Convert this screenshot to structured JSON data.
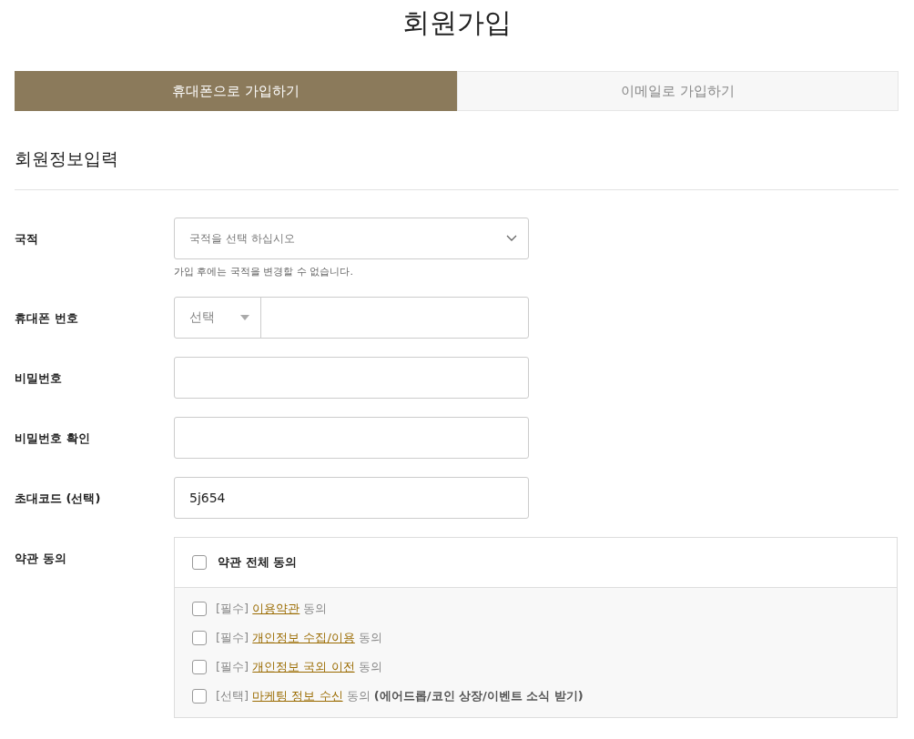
{
  "title": "회원가입",
  "tabs": [
    {
      "label": "휴대폰으로 가입하기",
      "selected": true
    },
    {
      "label": "이메일로 가입하기",
      "selected": false
    }
  ],
  "section_title": "회원정보입력",
  "fields": [
    {
      "kind": "select",
      "label": "국적",
      "placeholder": "국적을 선택 하십시오",
      "hint": "가입 후에는 국적을 변경할 수 없습니다."
    },
    {
      "kind": "phone",
      "label": "휴대폰 번호",
      "code": "선택"
    },
    {
      "kind": "password",
      "label": "비밀번호"
    },
    {
      "kind": "password",
      "label": "비밀번호 확인"
    },
    {
      "kind": "text",
      "label": "초대코드 (선택)",
      "value": "5j654"
    },
    {
      "kind": "terms",
      "label": "약관 동의"
    }
  ],
  "terms": {
    "all": {
      "label": "약관 전체 동의",
      "checked": false
    },
    "items": [
      {
        "tag": "[필수]",
        "link": "이용약관",
        "suffix": "동의",
        "checked": false
      },
      {
        "tag": "[필수]",
        "link": "개인정보 수집/이용",
        "suffix": "동의",
        "checked": false
      },
      {
        "tag": "[필수]",
        "link": "개인정보 국외 이전",
        "suffix": "동의",
        "checked": false
      },
      {
        "tag": "[선택]",
        "link": "마케팅 정보 수신",
        "suffix": "동의",
        "note": "(에어드롭/코인 상장/이벤트 소식 받기)",
        "checked": false
      }
    ]
  }
}
